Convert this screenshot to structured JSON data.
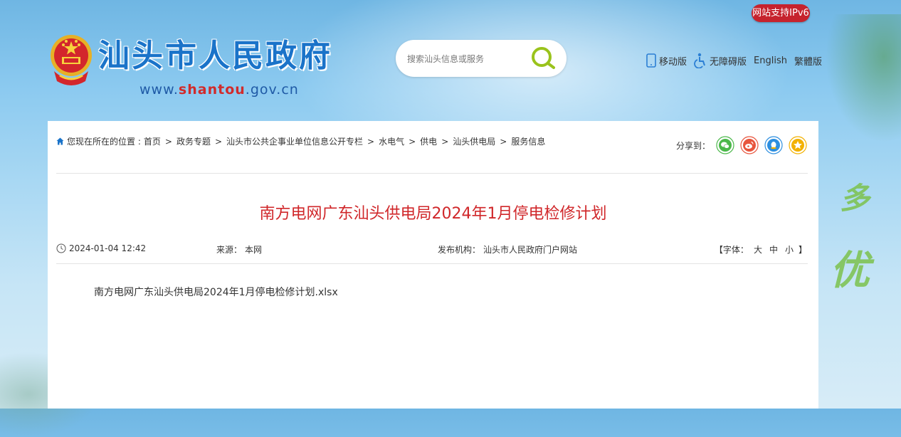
{
  "header": {
    "ipv6_badge": "网站支持IPv6",
    "site_title": "汕头市人民政府",
    "site_url_prefix": "www.",
    "site_url_highlight": "shantou",
    "site_url_suffix": ".gov.cn",
    "search": {
      "placeholder": "搜索汕头信息或服务"
    },
    "links": [
      {
        "label": "移动版",
        "icon": "mobile-icon"
      },
      {
        "label": "无障碍版",
        "icon": "accessibility-icon"
      },
      {
        "label": "English"
      },
      {
        "label": "繁體版"
      }
    ]
  },
  "decoration": {
    "glyph1": "多",
    "glyph2": "优"
  },
  "breadcrumb": {
    "prefix": "您现在所在的位置 :",
    "items": [
      "首页",
      "政务专题",
      "汕头市公共企事业单位信息公开专栏",
      "水电气",
      "供电",
      "汕头供电局",
      "服务信息"
    ],
    "separator": ">"
  },
  "share": {
    "label": "分享到：",
    "services": [
      {
        "name": "wechat",
        "color": "#4bb84a"
      },
      {
        "name": "weibo",
        "color": "#e8553d"
      },
      {
        "name": "qq",
        "color": "#2d8fe0"
      },
      {
        "name": "qzone",
        "color": "#f2b100"
      }
    ]
  },
  "article": {
    "title": "南方电网广东汕头供电局2024年1月停电检修计划",
    "date": "2024-01-04 12:42",
    "source_label": "来源：",
    "source": "本网",
    "publisher_label": "发布机构：",
    "publisher": "汕头市人民政府门户网站",
    "font_label": "【字体：",
    "font_large": "大",
    "font_medium": "中",
    "font_small": "小",
    "font_close": "】",
    "attachment": "南方电网广东汕头供电局2024年1月停电检修计划.xlsx"
  },
  "colors": {
    "accent_red": "#d0272a",
    "brand_blue": "#1a73c9",
    "badge_red": "#c6232d"
  }
}
